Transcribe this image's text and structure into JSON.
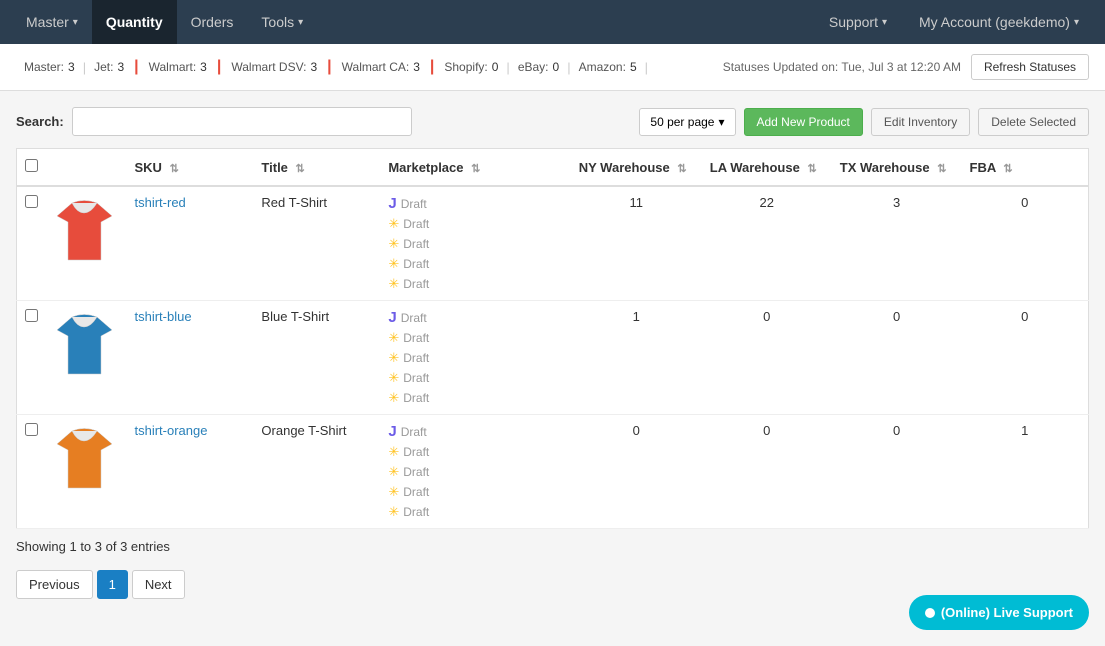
{
  "nav": {
    "items": [
      {
        "label": "Master",
        "id": "master",
        "caret": true
      },
      {
        "label": "Quantity",
        "id": "quantity",
        "active": true
      },
      {
        "label": "Orders",
        "id": "orders"
      },
      {
        "label": "Tools",
        "id": "tools",
        "caret": true
      }
    ],
    "right": [
      {
        "label": "Support",
        "id": "support",
        "caret": true
      },
      {
        "label": "My Account (geekdemo)",
        "id": "account",
        "caret": true
      }
    ]
  },
  "statusBar": {
    "items": [
      {
        "label": "Master:",
        "count": "3",
        "id": "master"
      },
      {
        "label": "Jet:",
        "count": "3",
        "id": "jet"
      },
      {
        "label": "Walmart:",
        "count": "3",
        "id": "walmart"
      },
      {
        "label": "Walmart DSV:",
        "count": "3",
        "id": "walmartDsv"
      },
      {
        "label": "Walmart CA:",
        "count": "3",
        "id": "walmartCa"
      },
      {
        "label": "Shopify:",
        "count": "0",
        "id": "shopify"
      },
      {
        "label": "eBay:",
        "count": "0",
        "id": "ebay"
      },
      {
        "label": "Amazon:",
        "count": "5",
        "id": "amazon"
      }
    ],
    "updated": "Statuses Updated on: Tue, Jul 3 at 12:20 AM",
    "refreshLabel": "Refresh Statuses"
  },
  "toolbar": {
    "searchLabel": "Search:",
    "searchPlaceholder": "",
    "perPageLabel": "50 per page",
    "addNewLabel": "Add New Product",
    "editInvLabel": "Edit Inventory",
    "deleteSelLabel": "Delete Selected"
  },
  "table": {
    "columns": [
      {
        "label": "",
        "id": "checkbox"
      },
      {
        "label": "",
        "id": "image"
      },
      {
        "label": "SKU",
        "id": "sku",
        "sortable": true
      },
      {
        "label": "Title",
        "id": "title",
        "sortable": true
      },
      {
        "label": "Marketplace",
        "id": "marketplace",
        "sortable": true
      },
      {
        "label": "NY Warehouse",
        "id": "ny",
        "sortable": true
      },
      {
        "label": "LA Warehouse",
        "id": "la",
        "sortable": true
      },
      {
        "label": "TX Warehouse",
        "id": "tx",
        "sortable": true
      },
      {
        "label": "FBA",
        "id": "fba",
        "sortable": true
      }
    ],
    "rows": [
      {
        "id": "row-1",
        "sku": "tshirt-red",
        "title": "Red T-Shirt",
        "color": "red",
        "marketplaces": [
          {
            "type": "jet",
            "status": "Draft"
          },
          {
            "type": "walmart",
            "status": "Draft"
          },
          {
            "type": "walmart",
            "status": "Draft"
          },
          {
            "type": "walmart",
            "status": "Draft"
          },
          {
            "type": "walmart",
            "status": "Draft"
          }
        ],
        "ny": "11",
        "la": "22",
        "tx": "3",
        "fba": "0"
      },
      {
        "id": "row-2",
        "sku": "tshirt-blue",
        "title": "Blue T-Shirt",
        "color": "blue",
        "marketplaces": [
          {
            "type": "jet",
            "status": "Draft"
          },
          {
            "type": "walmart",
            "status": "Draft"
          },
          {
            "type": "walmart",
            "status": "Draft"
          },
          {
            "type": "walmart",
            "status": "Draft"
          },
          {
            "type": "walmart",
            "status": "Draft"
          }
        ],
        "ny": "1",
        "la": "0",
        "tx": "0",
        "fba": "0"
      },
      {
        "id": "row-3",
        "sku": "tshirt-orange",
        "title": "Orange T-Shirt",
        "color": "orange",
        "marketplaces": [
          {
            "type": "jet",
            "status": "Draft"
          },
          {
            "type": "walmart",
            "status": "Draft"
          },
          {
            "type": "walmart",
            "status": "Draft"
          },
          {
            "type": "walmart",
            "status": "Draft"
          },
          {
            "type": "walmart",
            "status": "Draft"
          }
        ],
        "ny": "0",
        "la": "0",
        "tx": "0",
        "fba": "1"
      }
    ]
  },
  "pagination": {
    "showing": "Showing 1 to 3 of 3 entries",
    "prevLabel": "Previous",
    "nextLabel": "Next",
    "currentPage": "1"
  },
  "liveSupport": {
    "label": "(Online) Live Support"
  }
}
